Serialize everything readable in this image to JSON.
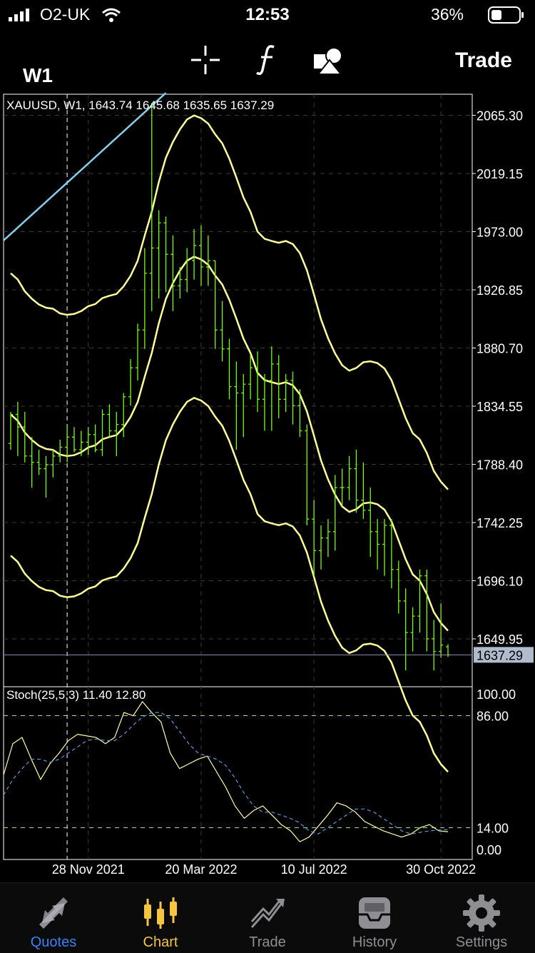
{
  "status_bar": {
    "carrier": "O2-UK",
    "time": "12:53",
    "battery": "36%"
  },
  "toolbar": {
    "period": "W1",
    "trade_label": "Trade",
    "icons": [
      "crosshair-icon",
      "function-icon",
      "objects-icon"
    ]
  },
  "chart_data": [
    {
      "type": "candlestick",
      "title": "XAUUSD, W1, 1643.74 1645.68 1635.65 1637.29",
      "symbol": "XAUUSD",
      "timeframe": "W1",
      "ohlc_header": {
        "open": 1643.74,
        "high": 1645.68,
        "low": 1635.65,
        "close": 1637.29
      },
      "y_ticks": [
        2065.3,
        2019.15,
        1973.0,
        1926.85,
        1880.7,
        1834.55,
        1788.4,
        1742.25,
        1696.1,
        1649.95
      ],
      "ylim": [
        1612,
        2082
      ],
      "current_price": 1637.29,
      "x_tick_labels": [
        "28 Nov 2021",
        "20 Mar 2022",
        "10 Jul 2022",
        "30 Oct 2022"
      ],
      "candle_color": "#7CFC00",
      "candles": [
        [
          1805,
          1830,
          1800,
          1828
        ],
        [
          1828,
          1838,
          1795,
          1818
        ],
        [
          1818,
          1830,
          1790,
          1795
        ],
        [
          1795,
          1810,
          1770,
          1790
        ],
        [
          1790,
          1800,
          1780,
          1785
        ],
        [
          1785,
          1795,
          1762,
          1788
        ],
        [
          1788,
          1800,
          1778,
          1795
        ],
        [
          1795,
          1808,
          1790,
          1802
        ],
        [
          1802,
          1820,
          1790,
          1810
        ],
        [
          1810,
          1818,
          1798,
          1800
        ],
        [
          1800,
          1815,
          1795,
          1806
        ],
        [
          1806,
          1818,
          1796,
          1812
        ],
        [
          1812,
          1820,
          1798,
          1800
        ],
        [
          1800,
          1832,
          1795,
          1828
        ],
        [
          1828,
          1836,
          1810,
          1815
        ],
        [
          1815,
          1830,
          1795,
          1820
        ],
        [
          1820,
          1845,
          1810,
          1842
        ],
        [
          1842,
          1872,
          1835,
          1865
        ],
        [
          1865,
          1900,
          1855,
          1895
        ],
        [
          1895,
          1960,
          1880,
          1940
        ],
        [
          1940,
          2075,
          1910,
          1960
        ],
        [
          1960,
          1990,
          1920,
          1980
        ],
        [
          1980,
          1985,
          1925,
          1955
        ],
        [
          1955,
          1970,
          1910,
          1930
        ],
        [
          1930,
          1945,
          1920,
          1935
        ],
        [
          1935,
          1960,
          1925,
          1950
        ],
        [
          1950,
          1975,
          1935,
          1962
        ],
        [
          1962,
          1978,
          1930,
          1945
        ],
        [
          1945,
          1970,
          1930,
          1950
        ],
        [
          1950,
          1950,
          1880,
          1895
        ],
        [
          1895,
          1918,
          1870,
          1880
        ],
        [
          1880,
          1888,
          1840,
          1850
        ],
        [
          1850,
          1870,
          1800,
          1845
        ],
        [
          1845,
          1860,
          1810,
          1852
        ],
        [
          1852,
          1875,
          1840,
          1865
        ],
        [
          1865,
          1878,
          1830,
          1840
        ],
        [
          1840,
          1860,
          1815,
          1855
        ],
        [
          1855,
          1882,
          1815,
          1868
        ],
        [
          1868,
          1875,
          1825,
          1840
        ],
        [
          1840,
          1860,
          1830,
          1855
        ],
        [
          1855,
          1862,
          1820,
          1835
        ],
        [
          1835,
          1848,
          1810,
          1815
        ],
        [
          1815,
          1820,
          1740,
          1745
        ],
        [
          1745,
          1760,
          1700,
          1720
        ],
        [
          1720,
          1740,
          1705,
          1730
        ],
        [
          1730,
          1745,
          1715,
          1735
        ],
        [
          1735,
          1780,
          1720,
          1770
        ],
        [
          1770,
          1785,
          1755,
          1770
        ],
        [
          1770,
          1795,
          1760,
          1785
        ],
        [
          1785,
          1800,
          1750,
          1760
        ],
        [
          1760,
          1790,
          1745,
          1752
        ],
        [
          1752,
          1770,
          1715,
          1735
        ],
        [
          1735,
          1745,
          1705,
          1725
        ],
        [
          1725,
          1745,
          1700,
          1740
        ],
        [
          1740,
          1745,
          1690,
          1705
        ],
        [
          1705,
          1712,
          1670,
          1680
        ],
        [
          1680,
          1690,
          1625,
          1655
        ],
        [
          1655,
          1675,
          1640,
          1668
        ],
        [
          1668,
          1705,
          1655,
          1700
        ],
        [
          1700,
          1705,
          1640,
          1650
        ],
        [
          1650,
          1665,
          1625,
          1640
        ],
        [
          1640,
          1678,
          1635,
          1645
        ],
        [
          1643.74,
          1645.68,
          1635.65,
          1637.29
        ]
      ],
      "indicator_color": "#ffff99",
      "ma_color": "#87ceeb"
    },
    {
      "type": "line",
      "title": "Stoch(25,5,3) 11.40 12.80",
      "y_ticks": [
        100.0,
        86.0,
        14.0,
        0.0
      ],
      "ylim": [
        0,
        100
      ],
      "levels": [
        86,
        14
      ],
      "series": [
        {
          "name": "main",
          "color": "#ffffaa",
          "values": [
            48,
            68,
            72,
            58,
            45,
            55,
            62,
            70,
            74,
            73,
            72,
            68,
            72,
            88,
            86,
            95,
            88,
            82,
            62,
            52,
            55,
            58,
            60,
            50,
            40,
            28,
            20,
            25,
            28,
            22,
            16,
            12,
            5,
            8,
            15,
            22,
            30,
            28,
            24,
            18,
            15,
            12,
            10,
            8,
            10,
            14,
            16,
            12,
            11.4
          ]
        },
        {
          "name": "signal",
          "color": "#5b9bd5",
          "values": [
            35,
            45,
            52,
            58,
            58,
            56,
            58,
            62,
            66,
            70,
            71,
            70,
            70,
            74,
            80,
            85,
            88,
            88,
            84,
            76,
            68,
            62,
            60,
            58,
            54,
            46,
            36,
            28,
            24,
            24,
            22,
            20,
            17,
            12,
            10,
            14,
            18,
            22,
            26,
            26,
            24,
            20,
            16,
            12,
            10,
            11,
            12,
            12.5,
            12.8
          ]
        }
      ]
    }
  ],
  "tab_bar": {
    "tabs": [
      {
        "label": "Quotes",
        "icon": "quotes-icon"
      },
      {
        "label": "Chart",
        "icon": "chart-icon"
      },
      {
        "label": "Trade",
        "icon": "trade-icon"
      },
      {
        "label": "History",
        "icon": "history-icon"
      },
      {
        "label": "Settings",
        "icon": "gear-icon"
      }
    ],
    "active_index": 1,
    "active_quotes_color": "#3b82f6",
    "active_chart_color": "#f5c542"
  }
}
